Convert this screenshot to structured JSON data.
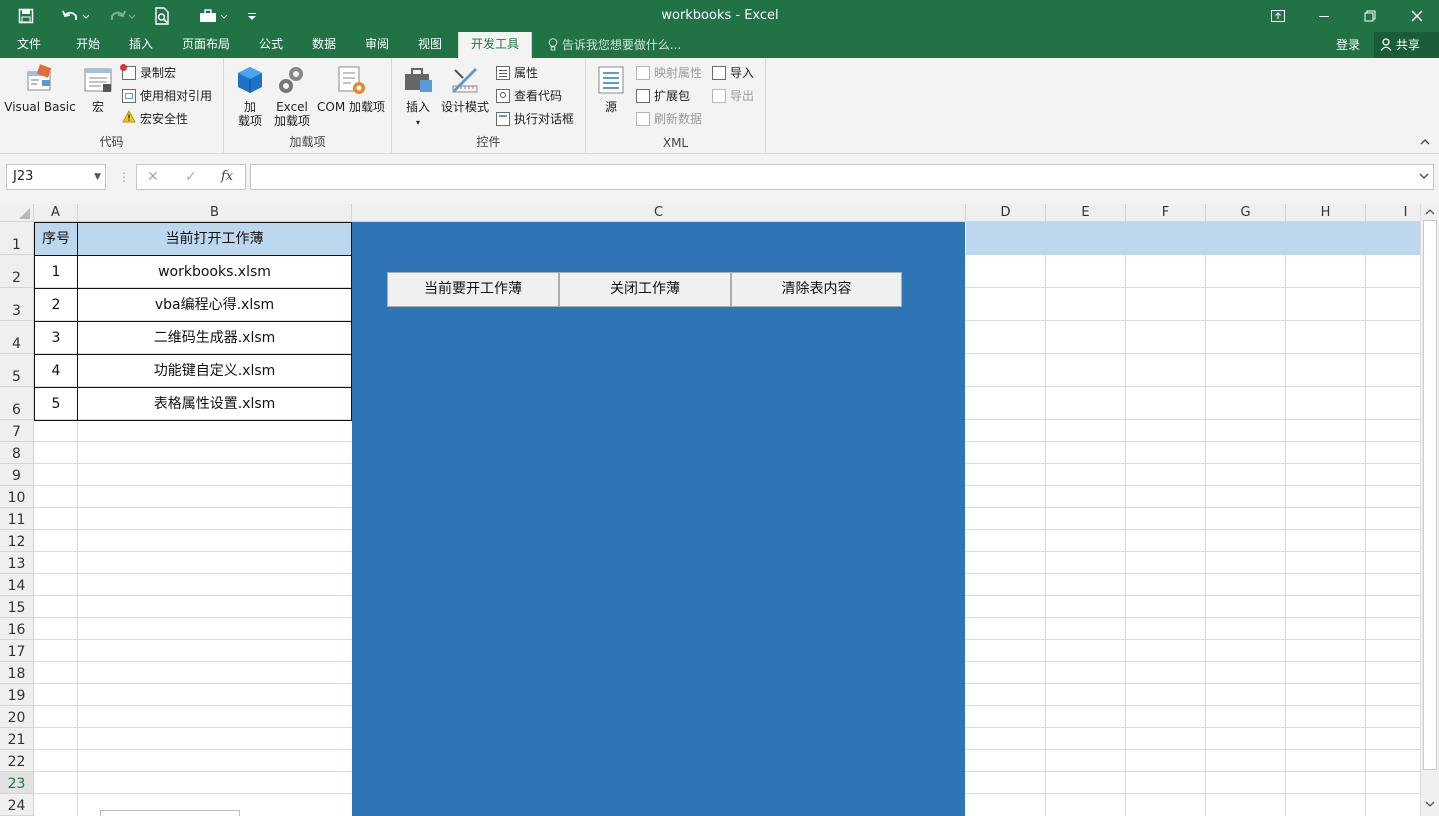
{
  "title": "workbooks - Excel",
  "quick_access": {
    "save_icon": "save-icon",
    "undo_icon": "undo-icon",
    "redo_icon": "redo-icon",
    "preview_icon": "print-preview-icon",
    "toolbox_icon": "toolbox-icon",
    "customize_icon": "customize-icon"
  },
  "tabs": [
    "文件",
    "开始",
    "插入",
    "页面布局",
    "公式",
    "数据",
    "审阅",
    "视图",
    "开发工具"
  ],
  "active_tab": "开发工具",
  "tell_me": "告诉我您想要做什么...",
  "login": "登录",
  "share": "共享",
  "ribbon": {
    "code": {
      "label": "代码",
      "visual_basic": "Visual Basic",
      "macro": "宏",
      "record": "录制宏",
      "relative": "使用相对引用",
      "security": "宏安全性"
    },
    "addins": {
      "label": "加载项",
      "addin_l1": "加",
      "addin_l2": "载项",
      "excel_l1": "Excel",
      "excel_l2": "加载项",
      "com": "COM 加载项"
    },
    "controls": {
      "label": "控件",
      "insert": "插入",
      "design": "设计模式",
      "properties": "属性",
      "view_code": "查看代码",
      "dialog": "执行对话框"
    },
    "xml": {
      "label": "XML",
      "source": "源",
      "map_props": "映射属性",
      "expansion": "扩展包",
      "refresh": "刷新数据",
      "import": "导入",
      "export": "导出"
    }
  },
  "formula_bar": {
    "name_box": "J23",
    "fx": "fx",
    "value": ""
  },
  "columns": [
    "A",
    "B",
    "C",
    "D",
    "E",
    "F",
    "G",
    "H",
    "I"
  ],
  "rows": [
    "1",
    "2",
    "3",
    "4",
    "5",
    "6",
    "7",
    "8",
    "9",
    "10",
    "11",
    "12",
    "13",
    "14",
    "15",
    "16",
    "17",
    "18",
    "19",
    "20",
    "21",
    "22",
    "23",
    "24"
  ],
  "table": {
    "headers": [
      "序号",
      "当前打开工作薄"
    ],
    "rows": [
      [
        "1",
        "workbooks.xlsm"
      ],
      [
        "2",
        "vba编程心得.xlsm"
      ],
      [
        "3",
        "二维码生成器.xlsm"
      ],
      [
        "4",
        "功能键自定义.xlsm"
      ],
      [
        "5",
        "表格属性设置.xlsm"
      ]
    ]
  },
  "buttons": [
    "当前要开工作薄",
    "关闭工作薄",
    "清除表内容"
  ],
  "colors": {
    "excel_green": "#217346",
    "panel_blue": "#2e75b6",
    "header_fill": "#bdd7ee"
  }
}
